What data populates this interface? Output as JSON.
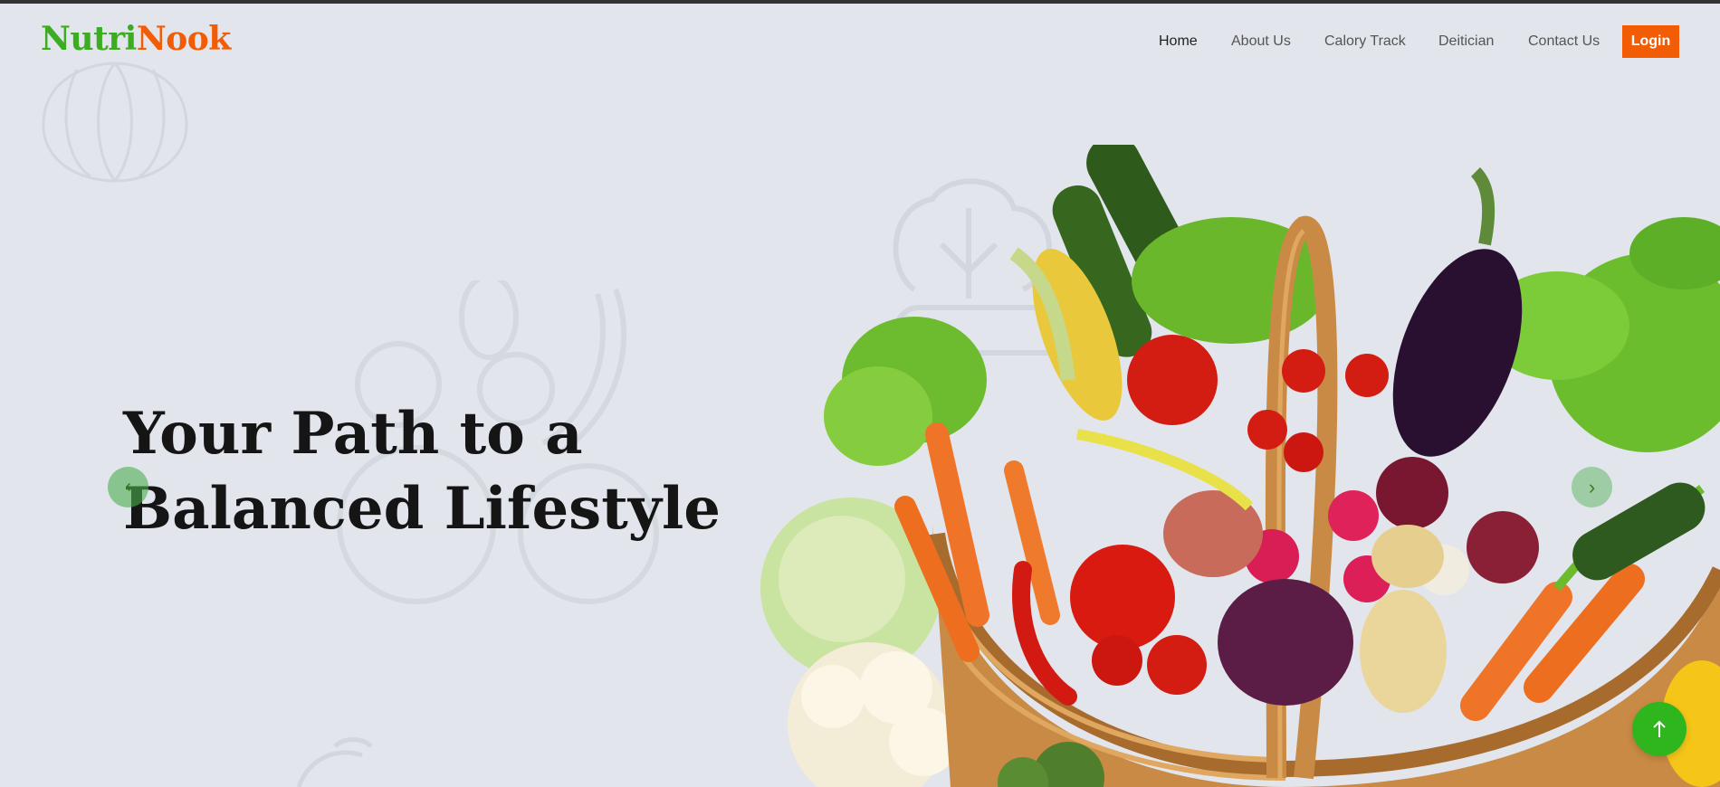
{
  "header": {
    "logo_part1": "Nutri",
    "logo_part2": "Nook",
    "nav": [
      {
        "label": "Home",
        "active": true
      },
      {
        "label": "About Us",
        "active": false
      },
      {
        "label": "Calory Track",
        "active": false
      },
      {
        "label": "Deitician",
        "active": false
      },
      {
        "label": "Contact Us",
        "active": false
      }
    ],
    "login_label": "Login"
  },
  "hero": {
    "title": "Your Path to a Balanced Lifestyle",
    "image": "vegetable-basket-image",
    "prev_icon": "chevron-left-icon",
    "next_icon": "chevron-right-icon"
  },
  "floating": {
    "scroll_top_icon": "arrow-up-icon"
  },
  "colors": {
    "background": "#e2e5ec",
    "brand_green": "#3cad23",
    "brand_orange": "#f25c05",
    "accent_green": "#2fb51e"
  }
}
